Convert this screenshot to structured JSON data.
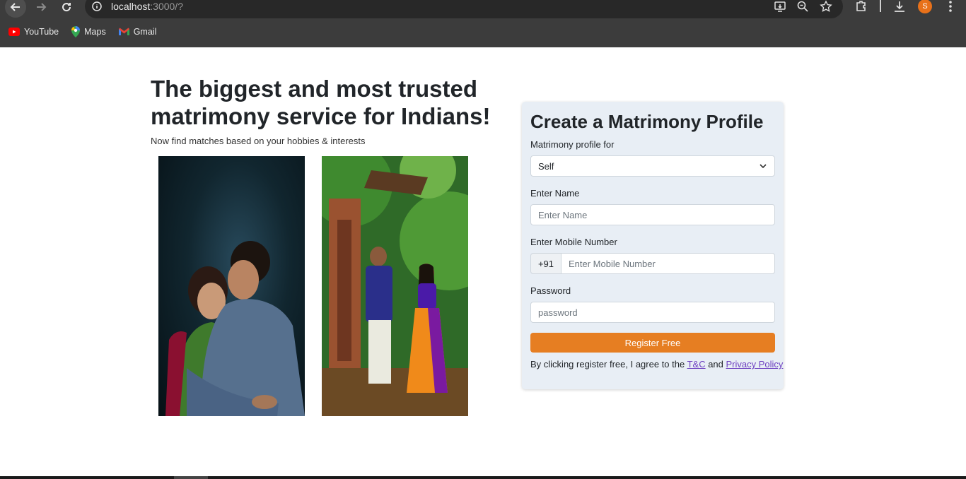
{
  "browser": {
    "url_host": "localhost",
    "url_rest": ":3000/?",
    "profile_initial": "S",
    "bookmarks": [
      {
        "label": "YouTube",
        "icon": "youtube-icon"
      },
      {
        "label": "Maps",
        "icon": "maps-icon"
      },
      {
        "label": "Gmail",
        "icon": "gmail-icon"
      }
    ]
  },
  "hero": {
    "title": "The biggest and most trusted matrimony service for Indians!",
    "subtitle": "Now find matches based on your hobbies & interests"
  },
  "form": {
    "title": "Create a Matrimony Profile",
    "profile_for_label": "Matrimony profile for",
    "profile_for_value": "Self",
    "name_label": "Enter Name",
    "name_placeholder": "Enter Name",
    "mobile_label": "Enter Mobile Number",
    "country_code": "+91",
    "mobile_placeholder": "Enter Mobile Number",
    "password_label": "Password",
    "password_placeholder": "password",
    "submit_label": "Register Free",
    "terms_prefix": "By clicking register free, I agree to the ",
    "terms_link": "T&C",
    "terms_and": " and ",
    "privacy_link": "Privacy Policy"
  },
  "colors": {
    "accent": "#e67e22",
    "card_bg": "#e8eef5",
    "link": "#6f42c1"
  }
}
